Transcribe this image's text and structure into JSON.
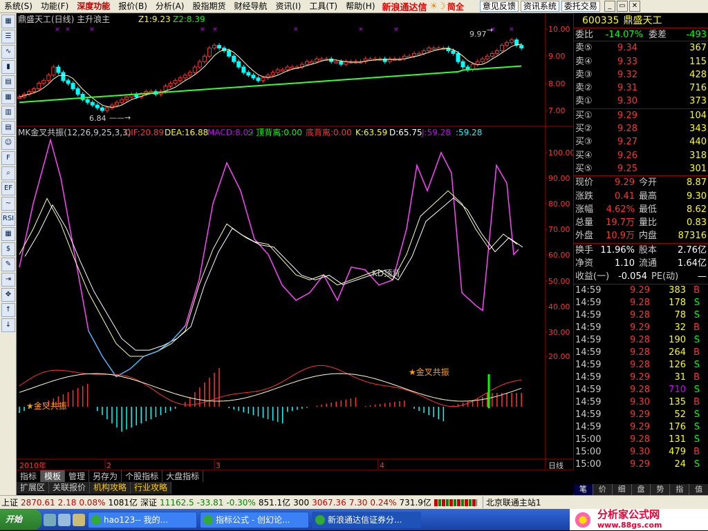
{
  "menu": {
    "items": [
      "系统(S)",
      "功能(F)",
      "深度功能",
      "报价(B)",
      "分析(A)",
      "股指期货",
      "财经导航",
      "资讯(I)",
      "工具(T)",
      "帮助(H)"
    ],
    "highlight_index": 2,
    "brand": "新浪通达信",
    "brand_extra": "简全",
    "buttons": [
      "意见反馈",
      "资讯系统",
      "委托交易"
    ]
  },
  "toolbar": {
    "icons": [
      "quote-icon",
      "list-icon",
      "kline-icon",
      "bars-icon",
      "report-icon",
      "grid-icon",
      "table-icon",
      "doc-icon",
      "people-icon",
      "f10-icon",
      "zoom-icon",
      "etf-icon",
      "wave-icon",
      "rsi-icon",
      "sheet-icon",
      "dollar-icon",
      "tool-icon",
      "exit-icon",
      "move-icon",
      "up-arrow-icon",
      "down-arrow-icon"
    ],
    "labels": [
      "▦",
      "☰",
      "∿",
      "▮",
      "▤",
      "▦",
      "▥",
      "▤",
      "☺",
      "F",
      "⌕",
      "EF",
      "∼",
      "RSI",
      "▦",
      "$",
      "✎",
      "⇥",
      "✥",
      "↑",
      "↓"
    ]
  },
  "main_chart": {
    "title": "鼎盛天工(日线) 主升浪主",
    "z1": "Z1:9.23",
    "z2": "Z2:8.39",
    "price_axis": [
      "10.00",
      "9.00",
      "8.00",
      "7.00"
    ],
    "high_label": "9.97",
    "low_label": "6.84"
  },
  "indicator": {
    "name": "MK金叉共振(12,26,9,25,3,3)",
    "dif": "DIF:20.89",
    "dea": "DEA:16.88",
    "macd": "MACD:8.02",
    "top_div": ":- 顶背离:0.00",
    "bottom_div": "底背离:0.00",
    "k": "K:63.59",
    "d": "D:65.75",
    "j": "J:59.28",
    "extra": ":59.28",
    "axis": [
      "100.00",
      "90.00",
      "80.00",
      "70.00",
      "60.00",
      "50.00",
      "40.00",
      "30.00",
      "20.00"
    ],
    "kd_label": "KD顶背",
    "golden1": "★金叉共振",
    "golden2": "★金叉共振"
  },
  "time_axis": {
    "labels": [
      "2010年",
      "2",
      "3",
      "4"
    ],
    "period": "日线"
  },
  "bottom_tabs1": [
    "指标",
    "模板",
    "管理",
    "另存为",
    "个股指标",
    "大盘指标"
  ],
  "bottom_tabs2": [
    "扩展区",
    "关联报价",
    "机构攻略",
    "行业攻略"
  ],
  "quote": {
    "code": "600335",
    "name": "鼎盛天工",
    "ratio_label": "委比",
    "ratio": "-14.07%",
    "diff_label": "委差",
    "diff": "-493",
    "asks": [
      {
        "label": "卖⑤",
        "price": "9.34",
        "vol": "367"
      },
      {
        "label": "卖④",
        "price": "9.33",
        "vol": "115"
      },
      {
        "label": "卖③",
        "price": "9.32",
        "vol": "428"
      },
      {
        "label": "卖②",
        "price": "9.31",
        "vol": "716"
      },
      {
        "label": "卖①",
        "price": "9.30",
        "vol": "373"
      }
    ],
    "bids": [
      {
        "label": "买①",
        "price": "9.29",
        "vol": "104"
      },
      {
        "label": "买②",
        "price": "9.28",
        "vol": "343"
      },
      {
        "label": "买③",
        "price": "9.27",
        "vol": "440"
      },
      {
        "label": "买④",
        "price": "9.26",
        "vol": "318"
      },
      {
        "label": "买⑤",
        "price": "9.25",
        "vol": "301"
      }
    ],
    "stats": [
      {
        "l1": "现价",
        "v1": "9.29",
        "l2": "今开",
        "v2": "8.87"
      },
      {
        "l1": "涨跌",
        "v1": "0.41",
        "l2": "最高",
        "v2": "9.30"
      },
      {
        "l1": "涨幅",
        "v1": "4.62%",
        "l2": "最低",
        "v2": "8.62"
      },
      {
        "l1": "总量",
        "v1": "19.7万",
        "l2": "量比",
        "v2": "0.83"
      },
      {
        "l1": "外盘",
        "v1": "10.9万",
        "l2": "内盘",
        "v2": "87316"
      }
    ],
    "stats2": [
      {
        "l1": "换手",
        "v1": "11.96%",
        "l2": "股本",
        "v2": "2.76亿"
      },
      {
        "l1": "净资",
        "v1": "1.10",
        "l2": "流通",
        "v2": "1.64亿"
      },
      {
        "l1": "收益(一)",
        "v1": "-0.054",
        "l2": "PE(动)",
        "v2": "—"
      }
    ]
  },
  "trades": [
    {
      "t": "14:59",
      "p": "9.29",
      "v": "383",
      "s": "B"
    },
    {
      "t": "14:59",
      "p": "9.28",
      "v": "178",
      "s": "S"
    },
    {
      "t": "14:59",
      "p": "9.28",
      "v": "78",
      "s": "S"
    },
    {
      "t": "14:59",
      "p": "9.29",
      "v": "32",
      "s": "B"
    },
    {
      "t": "14:59",
      "p": "9.28",
      "v": "190",
      "s": "S"
    },
    {
      "t": "14:59",
      "p": "9.28",
      "v": "264",
      "s": "B"
    },
    {
      "t": "14:59",
      "p": "9.28",
      "v": "126",
      "s": "S"
    },
    {
      "t": "14:59",
      "p": "9.29",
      "v": "31",
      "s": "B"
    },
    {
      "t": "14:59",
      "p": "9.28",
      "v": "710",
      "s": "S"
    },
    {
      "t": "14:59",
      "p": "9.30",
      "v": "135",
      "s": "B"
    },
    {
      "t": "14:59",
      "p": "9.29",
      "v": "52",
      "s": "S"
    },
    {
      "t": "14:59",
      "p": "9.29",
      "v": "176",
      "s": "S"
    },
    {
      "t": "15:00",
      "p": "9.28",
      "v": "131",
      "s": "S"
    },
    {
      "t": "15:00",
      "p": "9.30",
      "v": "479",
      "s": "B"
    },
    {
      "t": "15:00",
      "p": "9.29",
      "v": "24",
      "s": "S"
    }
  ],
  "rp_tabs": [
    "笔",
    "价",
    "细",
    "盘",
    "势",
    "指",
    "值"
  ],
  "status": {
    "sh_label": "上证",
    "sh_val": "2870.61",
    "sh_chg": "2.18",
    "sh_pct": "0.08%",
    "sh_amt": "1081亿",
    "sz_label": "深证",
    "sz_val": "11162.5",
    "sz_chg": "-33.81",
    "sz_pct": "-0.30%",
    "sz_amt": "851.1亿",
    "c3_label": "300",
    "c3_val": "3067.36",
    "c3_chg": "7.30",
    "c3_pct": "0.24%",
    "c3_amt": "731.9亿",
    "server": "北京联通主站1"
  },
  "taskbar": {
    "start": "开始",
    "items": [
      "hao123-- 我的...",
      "指标公式 - 创幻论...",
      "新浪通达信证券分..."
    ],
    "logo_main": "分析家公式网",
    "logo_sub": "www.88gs.com"
  },
  "colors": {
    "rise": "#ff3333",
    "fall": "#00ff00",
    "ma_green": "#33ff33",
    "k_line": "#ffffaa",
    "d_line": "#ffffff",
    "j_line": "#ff44ff"
  }
}
